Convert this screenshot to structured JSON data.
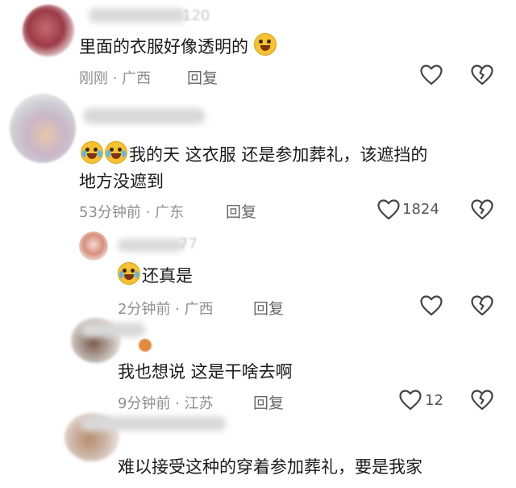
{
  "comments": [
    {
      "text": "里面的衣服好像透明的",
      "time_loc": "刚刚 · 广西",
      "reply": "回复",
      "likes": "",
      "username_partial": "120"
    },
    {
      "text_line1": "我的天 这衣服 还是参加葬礼，该遮挡的",
      "text_line2": "地方没遮到",
      "time_loc": "53分钟前 · 广东",
      "reply": "回复",
      "likes": "1824"
    },
    {
      "text": "还真是",
      "time_loc": "2分钟前 · 广西",
      "reply": "回复",
      "likes": "",
      "username_partial": "77"
    },
    {
      "text": "我也想说 这是干啥去啊",
      "time_loc": "9分钟前 · 江苏",
      "reply": "回复",
      "likes": "12"
    },
    {
      "text": "难以接受这种的穿着参加葬礼，要是我家"
    }
  ],
  "icons": {
    "like": "heart-outline-icon",
    "dislike": "broken-heart-icon",
    "laugh": "grinning-squint-emoji",
    "cry": "crying-laughing-emoji"
  },
  "colors": {
    "text": "#1a1a1a",
    "meta": "#8f8f8f",
    "icon_stroke": "#444444"
  }
}
